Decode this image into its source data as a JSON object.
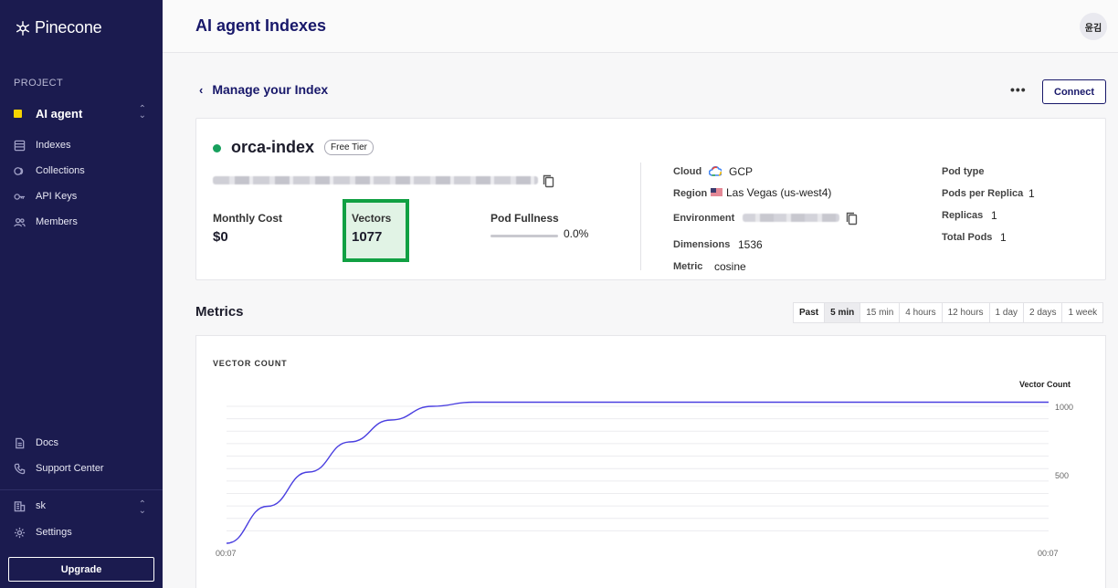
{
  "sidebar": {
    "logo": "Pinecone",
    "project_label": "PROJECT",
    "project_name": "AI agent",
    "nav": [
      {
        "label": "Indexes",
        "icon": "list-icon"
      },
      {
        "label": "Collections",
        "icon": "collections-icon"
      },
      {
        "label": "API Keys",
        "icon": "key-icon"
      },
      {
        "label": "Members",
        "icon": "members-icon"
      }
    ],
    "bottom": [
      {
        "label": "Docs",
        "icon": "doc-icon"
      },
      {
        "label": "Support Center",
        "icon": "phone-icon"
      }
    ],
    "org_name": "sk",
    "settings_label": "Settings",
    "upgrade_label": "Upgrade"
  },
  "header": {
    "title": "AI agent Indexes",
    "avatar_text": "윤김"
  },
  "manage": {
    "back_label": "Manage your Index",
    "more_label": "•••",
    "connect_label": "Connect"
  },
  "index": {
    "name": "orca-index",
    "tier": "Free Tier",
    "status_color": "#17a05d",
    "monthly_cost_label": "Monthly Cost",
    "monthly_cost": "$0",
    "vectors_label": "Vectors",
    "vectors": "1077",
    "pod_fullness_label": "Pod Fullness",
    "pod_fullness": "0.0%",
    "cloud_label": "Cloud",
    "cloud": "GCP",
    "region_label": "Region",
    "region": "Las Vegas (us-west4)",
    "environment_label": "Environment",
    "dimensions_label": "Dimensions",
    "dimensions": "1536",
    "metric_label": "Metric",
    "metric": "cosine",
    "pod_type_label": "Pod type",
    "pods_per_replica_label": "Pods per Replica",
    "pods_per_replica": "1",
    "replicas_label": "Replicas",
    "replicas": "1",
    "total_pods_label": "Total Pods",
    "total_pods": "1"
  },
  "metrics": {
    "title": "Metrics",
    "range_label": "Past",
    "ranges": [
      "5 min",
      "15 min",
      "4 hours",
      "12 hours",
      "1 day",
      "2 days",
      "1 week"
    ],
    "active_range": "5 min"
  },
  "chart_data": {
    "type": "line",
    "title": "VECTOR COUNT",
    "series": [
      {
        "name": "Vector Count",
        "color": "#4a3fe0",
        "x": [
          0,
          0.05,
          0.1,
          0.15,
          0.2,
          0.25,
          0.3,
          1.0
        ],
        "y": [
          0,
          270,
          520,
          740,
          900,
          1000,
          1030,
          1030
        ]
      }
    ],
    "x_tick_labels": [
      "00:07",
      "00:07"
    ],
    "y_ticks": [
      500,
      1000
    ],
    "ylim": [
      0,
      1100
    ],
    "grid": true,
    "legend": "top-right"
  }
}
